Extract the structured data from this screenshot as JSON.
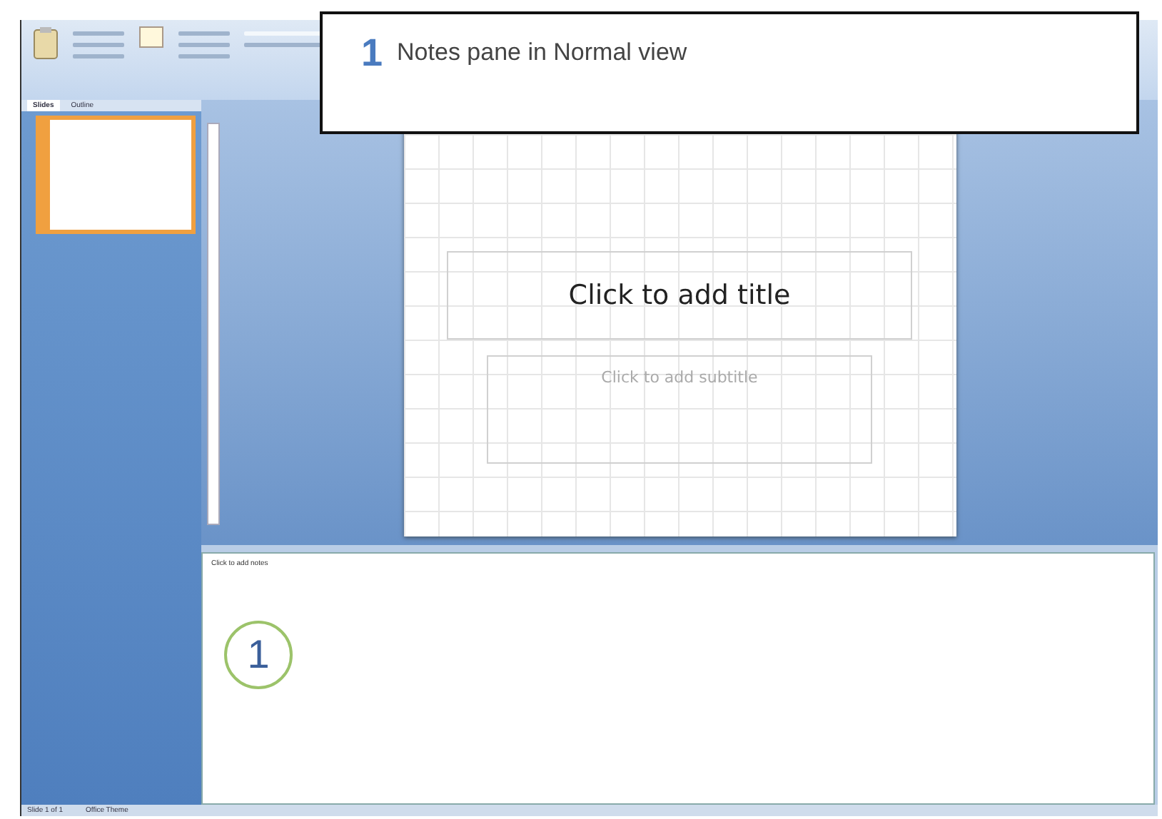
{
  "callout": {
    "number": "1",
    "text": "Notes pane in Normal view"
  },
  "panel_tabs": [
    {
      "label": "Slides",
      "selected": true
    },
    {
      "label": "Outline",
      "selected": false
    }
  ],
  "thumbnails": [
    {
      "selected": true
    }
  ],
  "slide": {
    "title_placeholder": "Click to add title",
    "subtitle_placeholder": "Click to add subtitle"
  },
  "notes": {
    "placeholder": "Click to add notes",
    "marker": "1"
  },
  "status_bar": {
    "slide": "Slide 1 of 1",
    "theme": "Office Theme"
  }
}
